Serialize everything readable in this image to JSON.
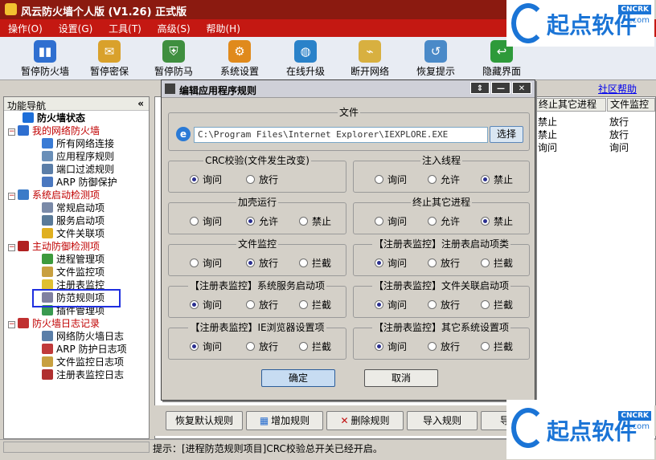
{
  "window": {
    "title": "风云防火墙个人版 (V1.26) 正式版"
  },
  "menu": [
    "操作(O)",
    "设置(G)",
    "工具(T)",
    "高级(S)",
    "帮助(H)"
  ],
  "toolbar": [
    {
      "label": "暂停防火墙",
      "icon": "firewall-pause-icon",
      "color": "#2f6fd0"
    },
    {
      "label": "暂停密保",
      "icon": "password-protect-icon",
      "color": "#d9a12b"
    },
    {
      "label": "暂停防马",
      "icon": "shield-icon",
      "color": "#3f8f3f"
    },
    {
      "label": "系统设置",
      "icon": "gear-icon",
      "color": "#e08a1c"
    },
    {
      "label": "在线升级",
      "icon": "globe-icon",
      "color": "#2a82c9"
    },
    {
      "label": "断开网络",
      "icon": "network-disconnect-icon",
      "color": "#d8b040"
    },
    {
      "label": "恢复提示",
      "icon": "restore-hint-icon",
      "color": "#4a8ac8"
    },
    {
      "label": "隐藏界面",
      "icon": "hide-window-icon",
      "color": "#2e9a3a"
    }
  ],
  "community_link": "社区帮助",
  "nav": {
    "header": "功能导航",
    "collapse": "«",
    "items": [
      {
        "label": "防火墙状态",
        "level": 1,
        "bold": true,
        "red": false
      },
      {
        "label": "我的网络防火墙",
        "level": 0,
        "red": true
      },
      {
        "label": "所有网络连接",
        "level": 2
      },
      {
        "label": "应用程序规则",
        "level": 2
      },
      {
        "label": "端口过滤规则",
        "level": 2
      },
      {
        "label": "ARP 防御保护",
        "level": 2
      },
      {
        "label": "系统启动检测项",
        "level": 0,
        "red": true
      },
      {
        "label": "常规启动项",
        "level": 2
      },
      {
        "label": "服务启动项",
        "level": 2
      },
      {
        "label": "文件关联项",
        "level": 2
      },
      {
        "label": "主动防御检测项",
        "level": 0,
        "red": true
      },
      {
        "label": "进程管理项",
        "level": 2
      },
      {
        "label": "文件监控项",
        "level": 2
      },
      {
        "label": "注册表监控",
        "level": 2
      },
      {
        "label": "防范规则项",
        "level": 2
      },
      {
        "label": "插件管理项",
        "level": 2
      },
      {
        "label": "防火墙日志记录",
        "level": 0,
        "red": true
      },
      {
        "label": "网络防火墙日志",
        "level": 2
      },
      {
        "label": "ARP 防护日志项",
        "level": 2
      },
      {
        "label": "文件监控日志项",
        "level": 2
      },
      {
        "label": "注册表监控日志",
        "level": 2
      }
    ]
  },
  "table": {
    "columns": [
      "终止其它进程",
      "文件监控"
    ],
    "rows": [
      [
        "禁止",
        "放行"
      ],
      [
        "禁止",
        "放行"
      ],
      [
        "询问",
        "询问"
      ]
    ]
  },
  "bottom_buttons": [
    "恢复默认规则",
    "增加规则",
    "删除规则",
    "导入规则",
    "导"
  ],
  "status": "提示：[进程防范规则项目]CRC校验总开关已经开启。",
  "dialog": {
    "title": "编辑应用程序规则",
    "controls": [
      "⇕",
      "—",
      "✕"
    ],
    "file_group": "文件",
    "file_path": "C:\\Program Files\\Internet Explorer\\IEXPLORE.EXE",
    "choose": "选择",
    "groups": [
      {
        "title": "CRC校验(文件发生改变)",
        "options": [
          "询问",
          "放行"
        ],
        "selected": 0
      },
      {
        "title": "注入线程",
        "options": [
          "询问",
          "允许",
          "禁止"
        ],
        "selected": 2
      },
      {
        "title": "加壳运行",
        "options": [
          "询问",
          "允许",
          "禁止"
        ],
        "selected": 1
      },
      {
        "title": "终止其它进程",
        "options": [
          "询问",
          "允许",
          "禁止"
        ],
        "selected": 2
      },
      {
        "title": "文件监控",
        "options": [
          "询问",
          "放行",
          "拦截"
        ],
        "selected": 1
      },
      {
        "title": "【注册表监控】注册表启动项类",
        "options": [
          "询问",
          "放行",
          "拦截"
        ],
        "selected": 0
      },
      {
        "title": "【注册表监控】系统服务启动项",
        "options": [
          "询问",
          "放行",
          "拦截"
        ],
        "selected": 0
      },
      {
        "title": "【注册表监控】文件关联启动项",
        "options": [
          "询问",
          "放行",
          "拦截"
        ],
        "selected": 0
      },
      {
        "title": "【注册表监控】IE浏览器设置项",
        "options": [
          "询问",
          "放行",
          "拦截"
        ],
        "selected": 0
      },
      {
        "title": "【注册表监控】其它系统设置项",
        "options": [
          "询问",
          "放行",
          "拦截"
        ],
        "selected": 0
      }
    ],
    "ok": "确定",
    "cancel": "取消"
  },
  "watermark": {
    "name": "起点软件",
    "tag": "CNCRK",
    "domain": ".com"
  }
}
